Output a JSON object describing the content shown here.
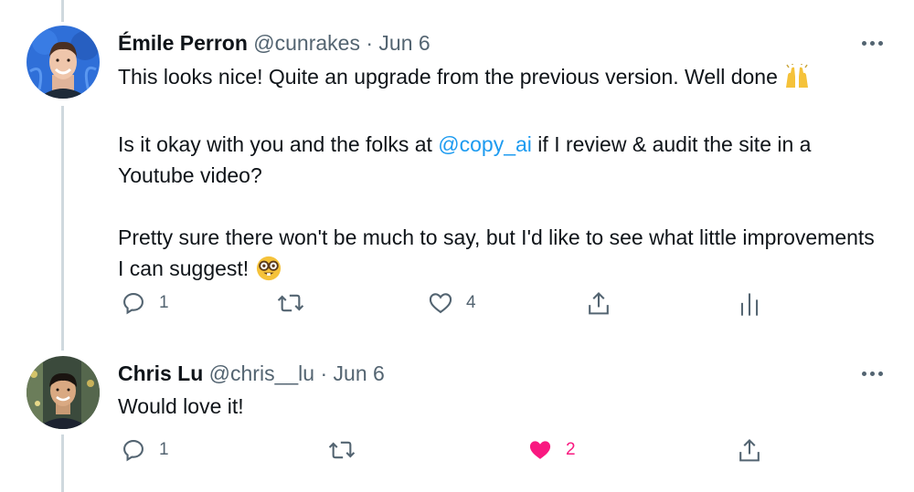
{
  "tweets": [
    {
      "author": {
        "name": "Émile Perron",
        "handle": "@cunrakes",
        "separator": "·",
        "date": "Jun 6"
      },
      "body": {
        "line1": "This looks nice! Quite an upgrade from the previous version. Well done",
        "p2_before": "Is it okay with you and the folks at ",
        "p2_mention": "@copy_ai",
        "p2_after": " if I review & audit the site in a Youtube video?",
        "p3": "Pretty sure there won't be much to say, but I'd like to see what little improvements I can suggest!"
      },
      "stats": {
        "replies": "1",
        "likes": "4"
      },
      "icons": {
        "more": "more-icon",
        "reply": "reply-icon",
        "retweet": "retweet-icon",
        "like": "heart-icon",
        "share": "share-icon",
        "analytics": "analytics-icon"
      }
    },
    {
      "author": {
        "name": "Chris Lu",
        "handle": "@chris__lu",
        "separator": "·",
        "date": "Jun 6"
      },
      "body": {
        "line1": "Would love it!"
      },
      "stats": {
        "replies": "1",
        "likes": "2"
      },
      "liked": true,
      "icons": {
        "more": "more-icon",
        "reply": "reply-icon",
        "retweet": "retweet-icon",
        "like": "heart-filled-icon",
        "share": "share-icon"
      }
    }
  ],
  "colors": {
    "text": "#0f1419",
    "muted": "#536471",
    "link": "#1d9bf0",
    "like": "#f91880",
    "thread_line": "#cfd9de"
  }
}
